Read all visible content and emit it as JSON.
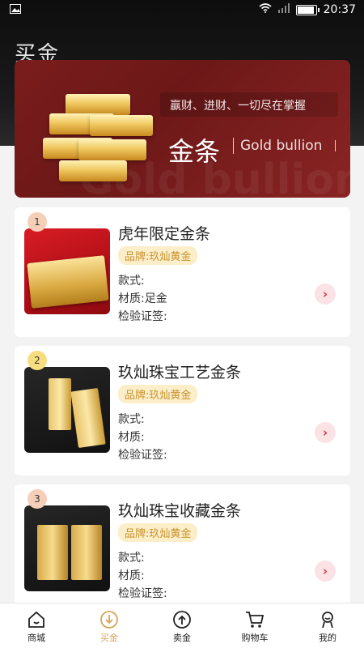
{
  "status": {
    "time": "20:37"
  },
  "page": {
    "title": "买金"
  },
  "banner": {
    "slogan": "赢财、进财、一切尽在掌握",
    "title": "金条",
    "subtitle": "Gold bullion",
    "watermark": "Gold bullion"
  },
  "products": [
    {
      "rank": "1",
      "name": "虎年限定金条",
      "brand": "品牌:玖灿黄金",
      "style": "款式:",
      "material": "材质:足金",
      "cert": "检验证签:"
    },
    {
      "rank": "2",
      "name": "玖灿珠宝工艺金条",
      "brand": "品牌:玖灿黄金",
      "style": "款式:",
      "material": "材质:",
      "cert": "检验证签:"
    },
    {
      "rank": "3",
      "name": "玖灿珠宝收藏金条",
      "brand": "品牌:玖灿黄金",
      "style": "款式:",
      "material": "材质:",
      "cert": "检验证签:"
    }
  ],
  "tabs": [
    {
      "label": "商城",
      "icon": "home-icon"
    },
    {
      "label": "买金",
      "icon": "buy-gold-icon",
      "active": true
    },
    {
      "label": "卖金",
      "icon": "sell-gold-icon"
    },
    {
      "label": "购物车",
      "icon": "cart-icon"
    },
    {
      "label": "我的",
      "icon": "profile-icon"
    }
  ],
  "colors": {
    "accent": "#d6a55a",
    "banner": "#7a1c1c",
    "arrow": "#d23349"
  },
  "battery_level": 0.85
}
